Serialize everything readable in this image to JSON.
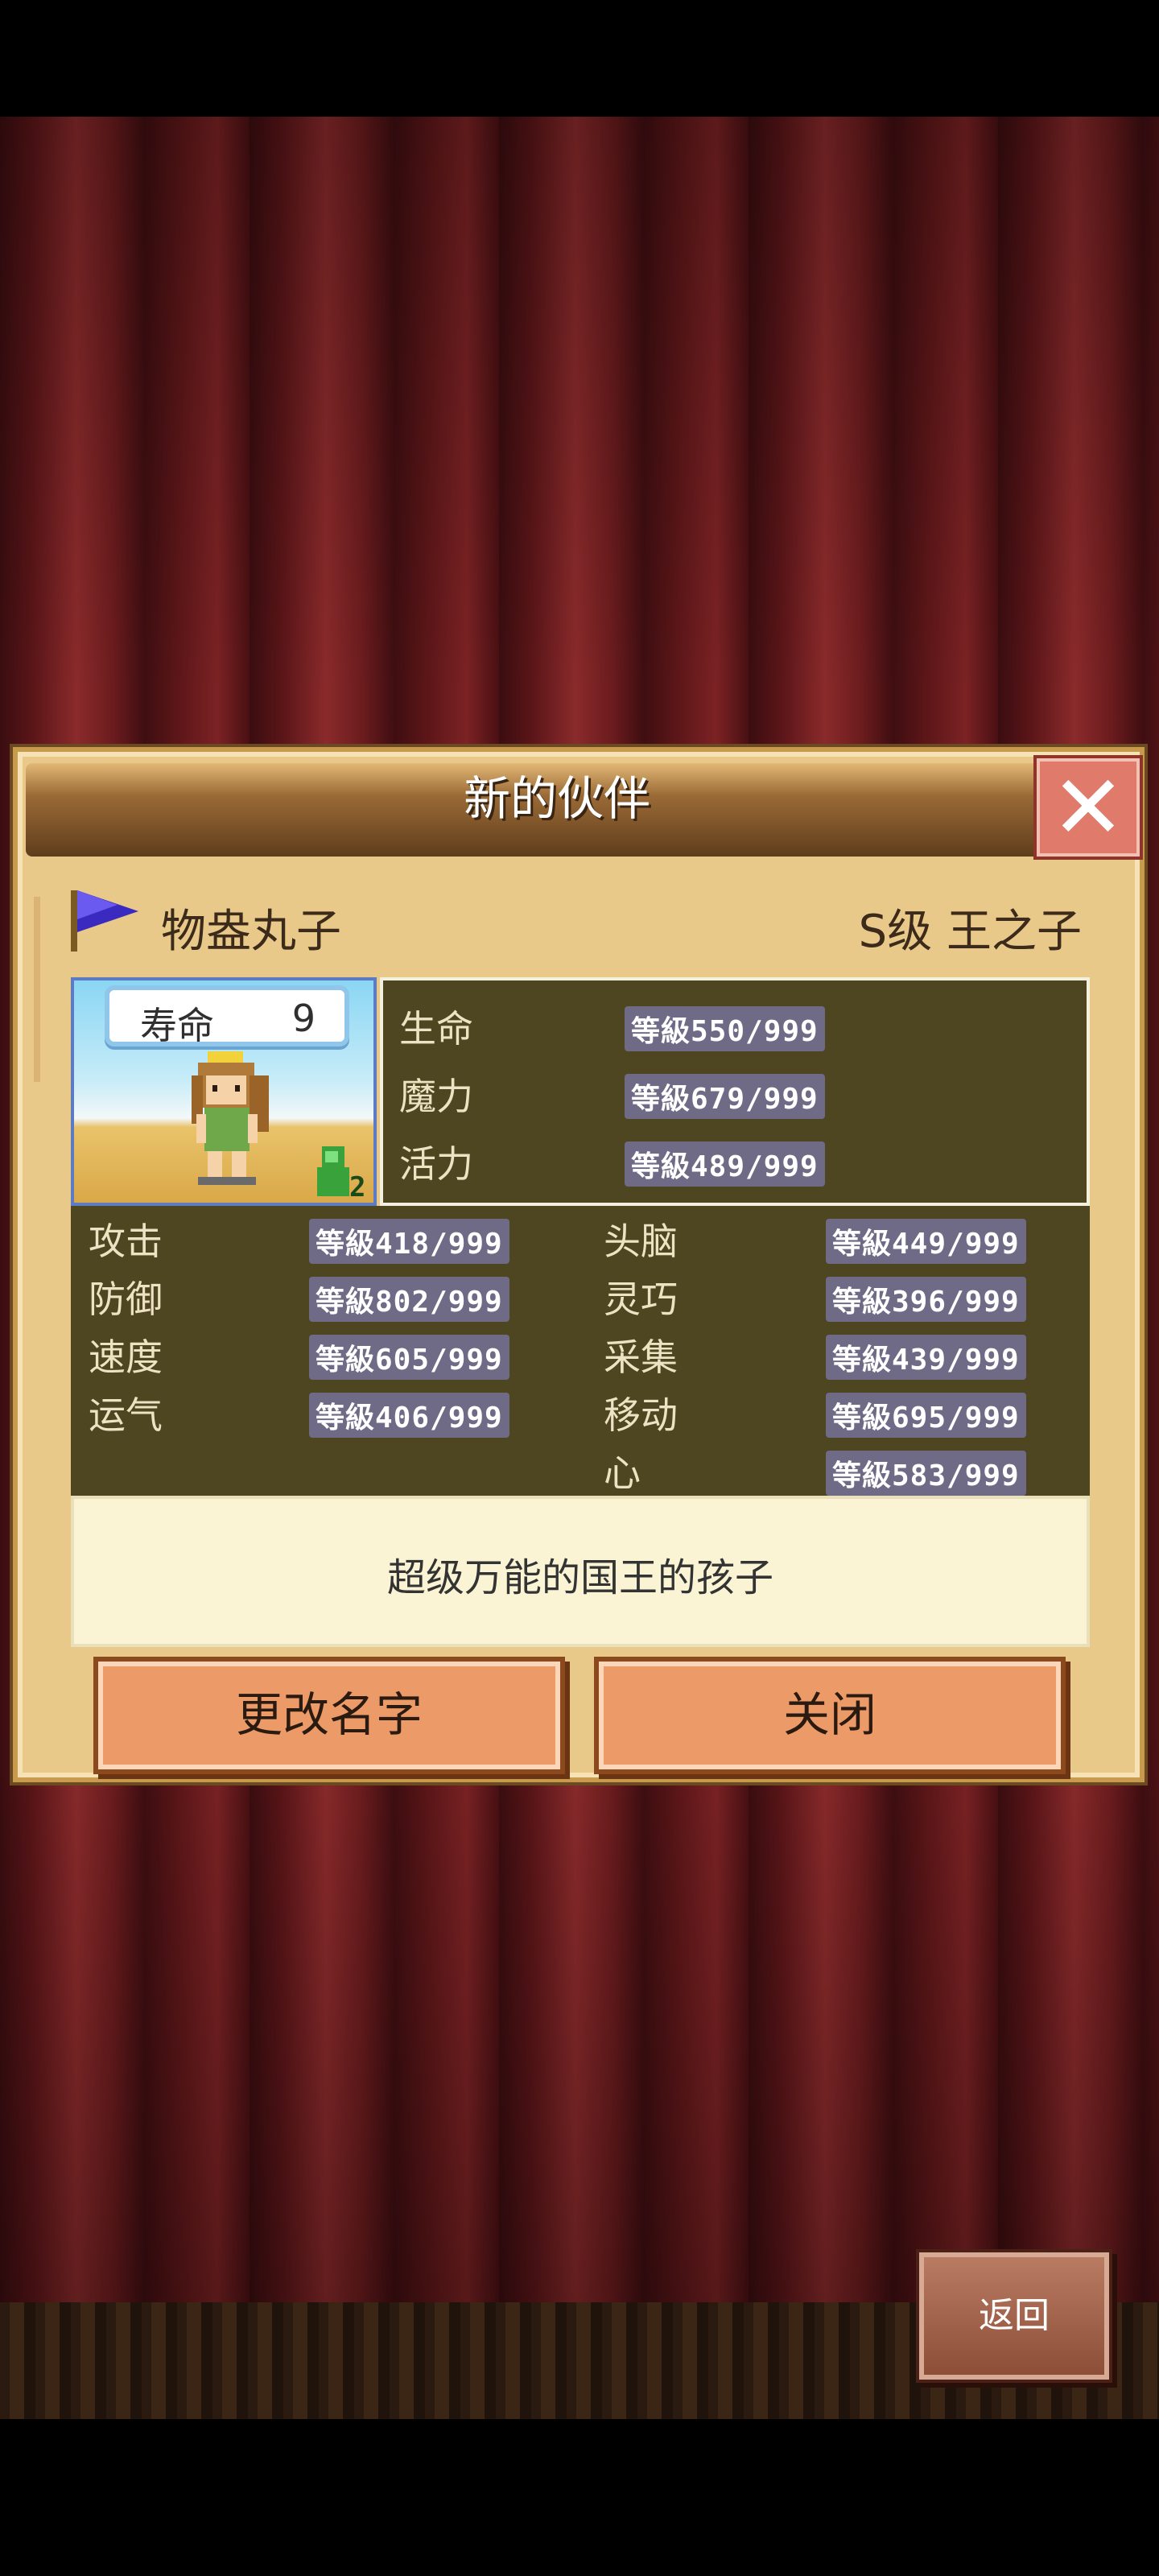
{
  "dialog": {
    "title": "新的伙伴",
    "close_symbol": "✕",
    "character_name": "物盎丸子",
    "rank": "S级 王之子",
    "lifespan_label": "寿命",
    "lifespan_value": "9",
    "generation_badge": "2",
    "top_stats": [
      {
        "label": "生命",
        "value": "等級550/999"
      },
      {
        "label": "魔力",
        "value": "等級679/999"
      },
      {
        "label": "活力",
        "value": "等級489/999"
      }
    ],
    "stats_left": [
      {
        "label": "攻击",
        "value": "等級418/999"
      },
      {
        "label": "防御",
        "value": "等級802/999"
      },
      {
        "label": "速度",
        "value": "等級605/999"
      },
      {
        "label": "运气",
        "value": "等級406/999"
      }
    ],
    "stats_right": [
      {
        "label": "头脑",
        "value": "等級449/999"
      },
      {
        "label": "灵巧",
        "value": "等級396/999"
      },
      {
        "label": "采集",
        "value": "等級439/999"
      },
      {
        "label": "移动",
        "value": "等級695/999"
      },
      {
        "label": "心",
        "value": "等級583/999"
      }
    ],
    "description": "超级万能的国王的孩子",
    "rename_button": "更改名字",
    "close_button": "关闭"
  },
  "back_button": "返回",
  "icons": [
    "flag-icon",
    "close-icon",
    "character-sprite",
    "generation-badge-icon"
  ],
  "colors": {
    "accent": "#eb9a68",
    "panel": "#4d4620",
    "frame": "#e9c98a",
    "curtain": "#6c1c1e"
  }
}
